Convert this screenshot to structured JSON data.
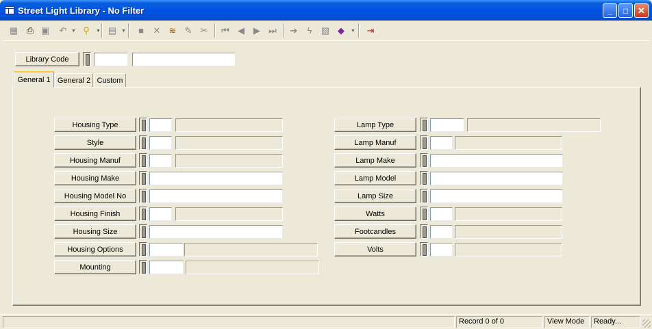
{
  "window": {
    "title": "Street Light Library - No Filter",
    "minimize": "_",
    "maximize": "□",
    "close": "✕"
  },
  "toolbar": {
    "icons": [
      "grid-icon",
      "printer-icon",
      "preview-icon",
      "undo-icon",
      "filter-icon",
      "form-icon",
      "save-icon",
      "delete-icon",
      "stack-icon",
      "edit-icon",
      "cut-icon",
      "first-record-icon",
      "previous-record-icon",
      "next-record-icon",
      "last-record-icon",
      "goto-icon",
      "lightning-icon",
      "report-icon",
      "book-icon",
      "exit-icon"
    ]
  },
  "header": {
    "library_code_label": "Library Code",
    "library_code_value": "",
    "library_desc_value": ""
  },
  "tabs": [
    {
      "label": "General 1",
      "active": true
    },
    {
      "label": "General 2",
      "active": false
    },
    {
      "label": "Custom",
      "active": false
    }
  ],
  "left_fields": [
    {
      "label": "Housing Type",
      "code": "",
      "desc": ""
    },
    {
      "label": "Style",
      "code": "",
      "desc": ""
    },
    {
      "label": "Housing Manuf",
      "code": "",
      "desc": ""
    },
    {
      "label": "Housing Make",
      "value": ""
    },
    {
      "label": "Housing Model No",
      "value": ""
    },
    {
      "label": "Housing Finish",
      "code": "",
      "desc": ""
    },
    {
      "label": "Housing Size",
      "value": ""
    },
    {
      "label": "Housing Options",
      "code": "",
      "desc": ""
    },
    {
      "label": "Mounting",
      "code": "",
      "desc": ""
    }
  ],
  "right_fields": [
    {
      "label": "Lamp Type",
      "code": "",
      "desc": ""
    },
    {
      "label": "Lamp Manuf",
      "code": "",
      "desc": ""
    },
    {
      "label": "Lamp Make",
      "value": ""
    },
    {
      "label": "Lamp Model",
      "value": ""
    },
    {
      "label": "Lamp Size",
      "value": ""
    },
    {
      "label": "Watts",
      "code": "",
      "desc": ""
    },
    {
      "label": "Footcandles",
      "code": "",
      "desc": ""
    },
    {
      "label": "Volts",
      "code": "",
      "desc": ""
    }
  ],
  "status": {
    "record": "Record 0 of 0",
    "mode": "View Mode",
    "state": "Ready..."
  }
}
